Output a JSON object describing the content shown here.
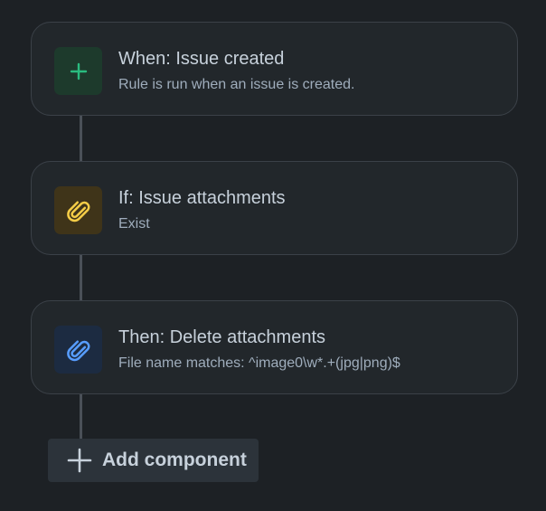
{
  "rule": {
    "components": [
      {
        "type": "trigger",
        "icon": "plus-icon",
        "color": "#2abb7f",
        "title": "When: Issue created",
        "subtitle": "Rule is run when an issue is created."
      },
      {
        "type": "condition",
        "icon": "paperclip-icon",
        "color": "#f5cd47",
        "title": "If: Issue attachments",
        "subtitle": "Exist"
      },
      {
        "type": "action",
        "icon": "paperclip-icon",
        "color": "#579dff",
        "title": "Then: Delete attachments",
        "subtitle": "File name matches: ^image0\\w*.+(jpg|png)$"
      }
    ],
    "add_button": {
      "icon": "plus-icon",
      "label": "Add component"
    }
  }
}
